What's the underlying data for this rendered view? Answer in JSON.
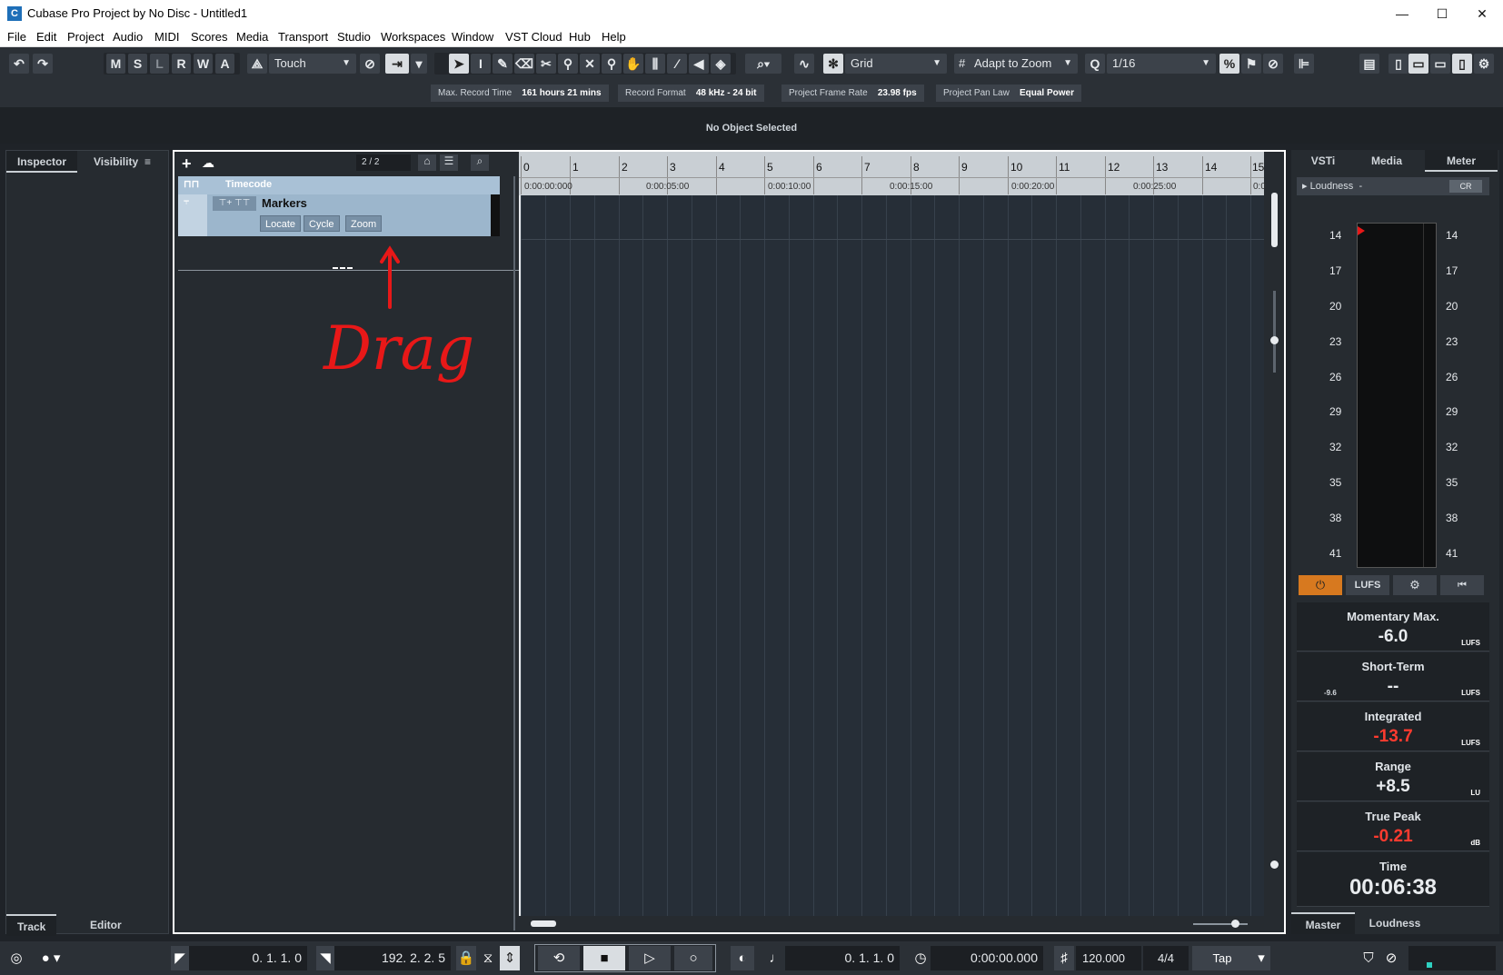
{
  "window": {
    "title": "Cubase Pro Project by No Disc - Untitled1",
    "controls": [
      "—",
      "☐",
      "✕"
    ]
  },
  "menu": [
    "File",
    "Edit",
    "Project",
    "Audio",
    "MIDI",
    "Scores",
    "Media",
    "Transport",
    "Studio",
    "Workspaces",
    "Window",
    "VST Cloud",
    "Hub",
    "Help"
  ],
  "toolbar": {
    "state_buttons": [
      "M",
      "S",
      "L",
      "R",
      "W",
      "A"
    ],
    "automation_mode": "Touch",
    "snap_type": "Grid",
    "grid_type": "Adapt to Zoom",
    "quantize": "1/16"
  },
  "infobar": {
    "max_record_label": "Max. Record Time",
    "max_record_value": "161 hours 21 mins",
    "record_format_label": "Record Format",
    "record_format_value": "48 kHz - 24 bit",
    "frame_rate_label": "Project Frame Rate",
    "frame_rate_value": "23.98 fps",
    "pan_law_label": "Project Pan Law",
    "pan_law_value": "Equal Power"
  },
  "status": "No Object Selected",
  "left_zone": {
    "tabs": [
      "Inspector",
      "Visibility"
    ],
    "menu_icon": "≡",
    "bottom_tabs": [
      "Track",
      "Editor"
    ]
  },
  "tracklist": {
    "count": "2 / 2",
    "tracks": {
      "timecode": "Timecode",
      "markers": "Markers",
      "marker_buttons": [
        "Locate",
        "Cycle",
        "Zoom"
      ]
    },
    "annotation": "Drag"
  },
  "ruler": {
    "bars": [
      "0",
      "1",
      "2",
      "3",
      "4",
      "5",
      "6",
      "7",
      "8",
      "9",
      "10",
      "11",
      "12",
      "13",
      "14",
      "15"
    ],
    "timecodes": [
      "0:00:00:000",
      "0:00:05:00",
      "0:00:10:00",
      "0:00:15:00",
      "0:00:20:00",
      "0:00:25:00",
      "0:0"
    ]
  },
  "right_zone": {
    "tabs": [
      "VSTi",
      "Media",
      "Meter"
    ],
    "loudness_header": "Loudness",
    "loudness_dash": "-",
    "cr_badge": "CR",
    "scale": [
      "14",
      "17",
      "20",
      "23",
      "26",
      "29",
      "32",
      "35",
      "38",
      "41"
    ],
    "lufs_button": "LUFS",
    "stats": [
      {
        "label": "Momentary Max.",
        "value": "-6.0",
        "unit": "LUFS",
        "color": "#e8ebee"
      },
      {
        "label": "Short-Term",
        "value": "--",
        "unit": "LUFS",
        "color": "#e8ebee",
        "sub": "-9.6"
      },
      {
        "label": "Integrated",
        "value": "-13.7",
        "unit": "LUFS",
        "color": "#ff3b2f"
      },
      {
        "label": "Range",
        "value": "+8.5",
        "unit": "LU",
        "color": "#e8ebee"
      },
      {
        "label": "True Peak",
        "value": "-0.21",
        "unit": "dB",
        "color": "#ff3b2f"
      },
      {
        "label": "Time",
        "value": "00:06:38",
        "unit": "",
        "color": "#e8ebee"
      }
    ],
    "bottom_tabs": [
      "Master",
      "Loudness"
    ]
  },
  "transport": {
    "left_locator": "0. 1. 1.   0",
    "right_locator": "192. 2. 2.   5",
    "position_bars": "0. 1. 1.   0",
    "position_time": "0:00:00.000",
    "tempo": "120.000",
    "signature": "4/4",
    "tap": "Tap"
  }
}
